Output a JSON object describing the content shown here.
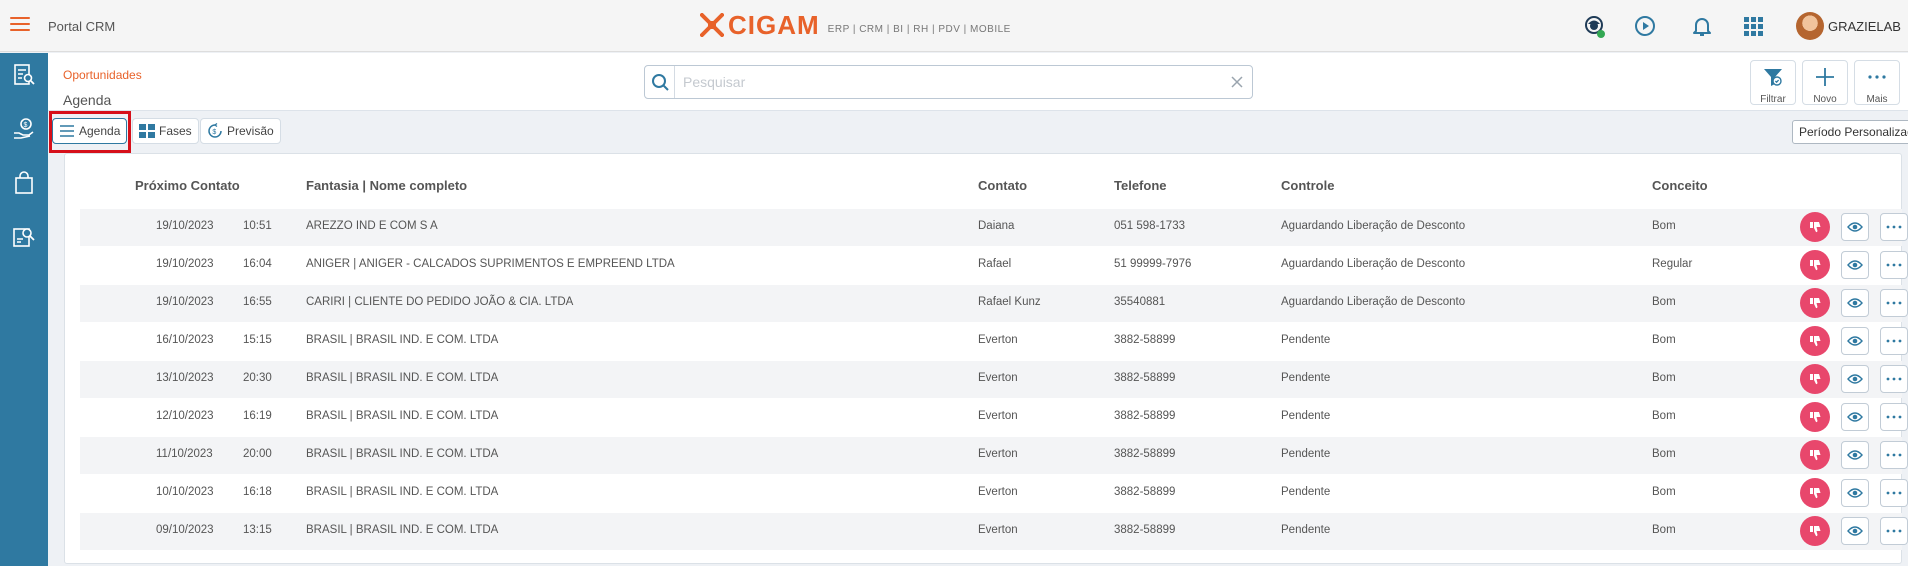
{
  "app": {
    "title": "Portal CRM",
    "logo_text": "CIGAM",
    "logo_sub": "ERP | CRM | BI | RH | PDV | MOBILE",
    "user_name": "GRAZIELAB"
  },
  "header": {
    "breadcrumb": "Oportunidades",
    "page_title": "Agenda",
    "search_placeholder": "Pesquisar",
    "actions": [
      {
        "label": "Filtrar",
        "icon": "filter-icon"
      },
      {
        "label": "Novo",
        "icon": "plus-icon"
      },
      {
        "label": "Mais",
        "icon": "more-icon"
      }
    ]
  },
  "views": [
    {
      "label": "Agenda",
      "icon": "list-icon",
      "active": true
    },
    {
      "label": "Fases",
      "icon": "grid-icon",
      "active": false
    },
    {
      "label": "Previsão",
      "icon": "forecast-icon",
      "active": false
    }
  ],
  "period_select": "Período Personalizado",
  "columns": [
    "Próximo Contato",
    "Fantasia | Nome completo",
    "Contato",
    "Telefone",
    "Controle",
    "Conceito"
  ],
  "rows": [
    {
      "date": "19/10/2023",
      "time": "10:51",
      "name": "AREZZO IND E COM S A",
      "contact": "Daiana",
      "phone": "051 598-1733",
      "control": "Aguardando Liberação de Desconto",
      "concept": "Bom"
    },
    {
      "date": "19/10/2023",
      "time": "16:04",
      "name": "ANIGER | ANIGER - CALCADOS SUPRIMENTOS E EMPREEND LTDA",
      "contact": "Rafael",
      "phone": "51 99999-7976",
      "control": "Aguardando Liberação de Desconto",
      "concept": "Regular"
    },
    {
      "date": "19/10/2023",
      "time": "16:55",
      "name": "CARIRI | CLIENTE DO PEDIDO JOÃO & CIA. LTDA",
      "contact": "Rafael Kunz",
      "phone": "35540881",
      "control": "Aguardando Liberação de Desconto",
      "concept": "Bom"
    },
    {
      "date": "16/10/2023",
      "time": "15:15",
      "name": "BRASIL | BRASIL IND. E COM. LTDA",
      "contact": "Everton",
      "phone": "3882-58899",
      "control": "Pendente",
      "concept": "Bom"
    },
    {
      "date": "13/10/2023",
      "time": "20:30",
      "name": "BRASIL | BRASIL IND. E COM. LTDA",
      "contact": "Everton",
      "phone": "3882-58899",
      "control": "Pendente",
      "concept": "Bom"
    },
    {
      "date": "12/10/2023",
      "time": "16:19",
      "name": "BRASIL | BRASIL IND. E COM. LTDA",
      "contact": "Everton",
      "phone": "3882-58899",
      "control": "Pendente",
      "concept": "Bom"
    },
    {
      "date": "11/10/2023",
      "time": "20:00",
      "name": "BRASIL | BRASIL IND. E COM. LTDA",
      "contact": "Everton",
      "phone": "3882-58899",
      "control": "Pendente",
      "concept": "Bom"
    },
    {
      "date": "10/10/2023",
      "time": "16:18",
      "name": "BRASIL | BRASIL IND. E COM. LTDA",
      "contact": "Everton",
      "phone": "3882-58899",
      "control": "Pendente",
      "concept": "Bom"
    },
    {
      "date": "09/10/2023",
      "time": "13:15",
      "name": "BRASIL | BRASIL IND. E COM. LTDA",
      "contact": "Everton",
      "phone": "3882-58899",
      "control": "Pendente",
      "concept": "Bom"
    }
  ],
  "colors": {
    "accent": "#e8622a",
    "sidebar": "#2f79a1",
    "dislike": "#e8476c",
    "highlight": "#d6101a"
  }
}
